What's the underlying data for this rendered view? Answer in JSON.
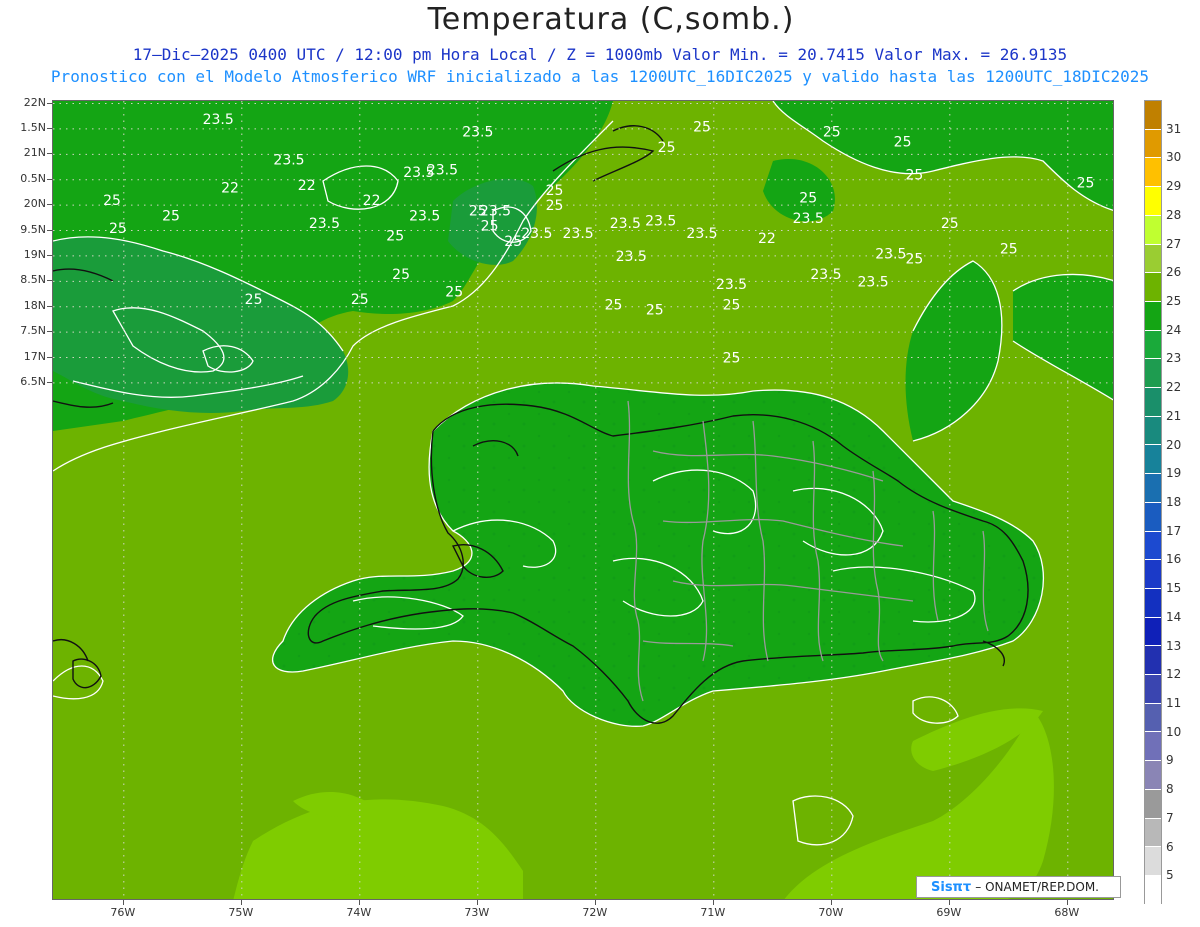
{
  "title": "Temperatura (C,somb.)",
  "subtitle_line1": "17–Dic–2025 0400 UTC / 12:00 pm Hora Local / Z = 1000mb  Valor Min. = 20.7415  Valor Max. = 26.9135",
  "subtitle_line2": "Pronostico con el Modelo Atmosferico WRF inicializado a las 1200UTC_16DIC2025 y valido hasta las  1200UTC_18DIC2025",
  "map": {
    "lon_range": [
      -76.6,
      -67.6
    ],
    "lat_range": [
      6.3,
      22.05
    ],
    "lat_labels": [
      "22N",
      "1.5N",
      "21N",
      "0.5N",
      "20N",
      "9.5N",
      "19N",
      "8.5N",
      "18N",
      "7.5N",
      "17N",
      "6.5N"
    ],
    "lat_values": [
      22,
      21.5,
      21,
      20.5,
      20,
      19.5,
      19,
      18.5,
      18,
      17.5,
      17,
      16.5
    ],
    "lon_labels": [
      "76W",
      "75W",
      "74W",
      "73W",
      "72W",
      "71W",
      "70W",
      "69W",
      "68W"
    ],
    "lon_values": [
      -76,
      -75,
      -74,
      -73,
      -72,
      -71,
      -70,
      -69,
      -68
    ],
    "background_color": "#6db300",
    "land_color": "#14a514",
    "cool_color": "#1a9c3a",
    "warm_color": "#7fcc00",
    "contour_labels": [
      {
        "text": "23.5",
        "lon": -74.6,
        "lat": 20.8
      },
      {
        "text": "23.5",
        "lon": -73.0,
        "lat": 21.35
      },
      {
        "text": "23.5",
        "lon": -73.3,
        "lat": 20.6
      },
      {
        "text": "23.5",
        "lon": -75.2,
        "lat": 21.6
      },
      {
        "text": "22",
        "lon": -74.45,
        "lat": 20.3
      },
      {
        "text": "22",
        "lon": -75.1,
        "lat": 20.25
      },
      {
        "text": "22",
        "lon": -73.9,
        "lat": 20.0
      },
      {
        "text": "23.5",
        "lon": -73.45,
        "lat": 19.7
      },
      {
        "text": "23.5",
        "lon": -74.3,
        "lat": 19.55
      },
      {
        "text": "25",
        "lon": -75.6,
        "lat": 19.7
      },
      {
        "text": "25",
        "lon": -73.7,
        "lat": 19.3
      },
      {
        "text": "25",
        "lon": -72.35,
        "lat": 20.2
      },
      {
        "text": "25",
        "lon": -72.7,
        "lat": 19.2
      },
      {
        "text": "25",
        "lon": -71.1,
        "lat": 21.45
      },
      {
        "text": "25",
        "lon": -71.4,
        "lat": 21.05
      },
      {
        "text": "25",
        "lon": -70.0,
        "lat": 21.35
      },
      {
        "text": "25",
        "lon": -69.4,
        "lat": 21.15
      },
      {
        "text": "25",
        "lon": -70.2,
        "lat": 20.05
      },
      {
        "text": "25",
        "lon": -69.3,
        "lat": 20.5
      },
      {
        "text": "25",
        "lon": -69.0,
        "lat": 19.55
      },
      {
        "text": "25",
        "lon": -68.5,
        "lat": 19.05
      },
      {
        "text": "25",
        "lon": -73.0,
        "lat": 19.8
      },
      {
        "text": "25",
        "lon": -72.35,
        "lat": 19.9
      },
      {
        "text": "25",
        "lon": -73.65,
        "lat": 18.55
      },
      {
        "text": "25",
        "lon": -73.2,
        "lat": 18.2
      },
      {
        "text": "25",
        "lon": -74.9,
        "lat": 18.05
      },
      {
        "text": "25",
        "lon": -74.0,
        "lat": 18.05
      },
      {
        "text": "25",
        "lon": -71.85,
        "lat": 17.95
      },
      {
        "text": "25",
        "lon": -70.85,
        "lat": 17.95
      },
      {
        "text": "25",
        "lon": -70.85,
        "lat": 16.9
      },
      {
        "text": "25",
        "lon": -69.3,
        "lat": 18.85
      },
      {
        "text": "25",
        "lon": -67.85,
        "lat": 20.35
      },
      {
        "text": "25",
        "lon": -76.05,
        "lat": 19.45
      },
      {
        "text": "25",
        "lon": -76.1,
        "lat": 20.0
      },
      {
        "text": "23.5",
        "lon": -72.85,
        "lat": 19.8
      },
      {
        "text": "23.5",
        "lon": -72.15,
        "lat": 19.35
      },
      {
        "text": "23.5",
        "lon": -71.45,
        "lat": 19.6
      },
      {
        "text": "23.5",
        "lon": -71.1,
        "lat": 19.35
      },
      {
        "text": "23.5",
        "lon": -70.2,
        "lat": 19.65
      },
      {
        "text": "23.5",
        "lon": -71.7,
        "lat": 18.9
      },
      {
        "text": "23.5",
        "lon": -70.05,
        "lat": 18.55
      },
      {
        "text": "23.5",
        "lon": -69.5,
        "lat": 18.95
      },
      {
        "text": "23.5",
        "lon": -69.65,
        "lat": 18.4
      },
      {
        "text": "23.5",
        "lon": -70.85,
        "lat": 18.35
      },
      {
        "text": "25",
        "lon": -72.9,
        "lat": 19.5
      },
      {
        "text": "25",
        "lon": -71.5,
        "lat": 17.85
      },
      {
        "text": "22",
        "lon": -70.55,
        "lat": 19.25
      },
      {
        "text": "23.5",
        "lon": -72.5,
        "lat": 19.35
      },
      {
        "text": "23.5",
        "lon": -71.75,
        "lat": 19.55
      },
      {
        "text": "23.5",
        "lon": -73.5,
        "lat": 20.55
      }
    ]
  },
  "colorbar": {
    "levels": [
      "31",
      "30",
      "29",
      "28",
      "27",
      "26",
      "25",
      "24",
      "23",
      "22",
      "21",
      "20",
      "19",
      "18",
      "17",
      "16",
      "15",
      "14",
      "13",
      "12",
      "11",
      "10",
      "9",
      "8",
      "7",
      "6",
      "5"
    ],
    "colors": [
      "#c08000",
      "#e09a00",
      "#ffc000",
      "#ffff00",
      "#c0ff30",
      "#9acd32",
      "#6db300",
      "#14a514",
      "#1aaa3a",
      "#1e9c50",
      "#1a8f6a",
      "#198a7e",
      "#17829a",
      "#1a6fb0",
      "#1a5cc0",
      "#1c4ad0",
      "#1b3ac8",
      "#1330c0",
      "#0f20b8",
      "#2230b0",
      "#3a45b0",
      "#5560b0",
      "#7070b8",
      "#8a85b5",
      "#9a9a9a",
      "#b8b8b8",
      "#dcdcdc",
      "#ffffff"
    ]
  },
  "credit": {
    "logo": "Sisπτ",
    "org": "– ONAMET/REP.DOM."
  }
}
